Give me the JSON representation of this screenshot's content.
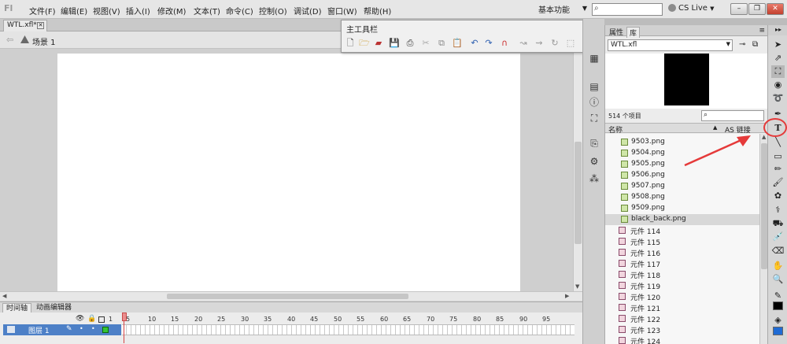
{
  "menu": [
    "文件(F)",
    "编辑(E)",
    "视图(V)",
    "插入(I)",
    "修改(M)",
    "文本(T)",
    "命令(C)",
    "控制(O)",
    "调试(D)",
    "窗口(W)",
    "帮助(H)"
  ],
  "logo_text": "Fl",
  "workspace": "基本功能",
  "cslive": "CS Live",
  "doc_tab": "WTL.xfl*",
  "scene_label": "场景 1",
  "main_toolbar_title": "主工具栏",
  "timeline_tabs": [
    "时间轴",
    "动画编辑器"
  ],
  "layer_name": "图层 1",
  "frame_numbers": [
    "1",
    "5",
    "10",
    "15",
    "20",
    "25",
    "30",
    "35",
    "40",
    "45",
    "50",
    "55",
    "60",
    "65",
    "70",
    "75",
    "80",
    "85",
    "90",
    "95"
  ],
  "library": {
    "tabs": [
      "属性",
      "库"
    ],
    "file": "WTL.xfl",
    "count_text": "514 个项目",
    "col_name": "名称",
    "col_linkage": "AS 链接",
    "items": [
      {
        "name": "9503.png",
        "type": "bitmap"
      },
      {
        "name": "9504.png",
        "type": "bitmap"
      },
      {
        "name": "9505.png",
        "type": "bitmap"
      },
      {
        "name": "9506.png",
        "type": "bitmap"
      },
      {
        "name": "9507.png",
        "type": "bitmap"
      },
      {
        "name": "9508.png",
        "type": "bitmap"
      },
      {
        "name": "9509.png",
        "type": "bitmap"
      },
      {
        "name": "black_back.png",
        "type": "bitmap",
        "selected": true
      },
      {
        "name": "元件 114",
        "type": "symbol"
      },
      {
        "name": "元件 115",
        "type": "symbol"
      },
      {
        "name": "元件 116",
        "type": "symbol"
      },
      {
        "name": "元件 117",
        "type": "symbol"
      },
      {
        "name": "元件 118",
        "type": "symbol"
      },
      {
        "name": "元件 119",
        "type": "symbol"
      },
      {
        "name": "元件 120",
        "type": "symbol"
      },
      {
        "name": "元件 121",
        "type": "symbol"
      },
      {
        "name": "元件 122",
        "type": "symbol"
      },
      {
        "name": "元件 123",
        "type": "symbol"
      },
      {
        "name": "元件 124",
        "type": "symbol"
      }
    ]
  },
  "colors": {
    "accent_highlight": "#e53a3a",
    "layer_selected": "#4d80c7",
    "preview_black": "#000000"
  }
}
